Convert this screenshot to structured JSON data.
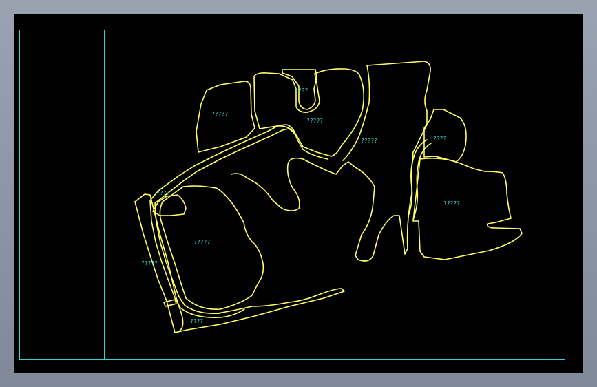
{
  "colors": {
    "background": "#000000",
    "frame": "#2fd4d4",
    "outline": "#ffff66",
    "label": "#35e0e0",
    "chrome": "#8d96a4"
  },
  "labels": {
    "a": "?????",
    "b": "????",
    "c": "?????",
    "d": "?????",
    "e": "????",
    "f": "????",
    "g": "?????",
    "h": "?????",
    "i": "?????",
    "j": "????"
  }
}
